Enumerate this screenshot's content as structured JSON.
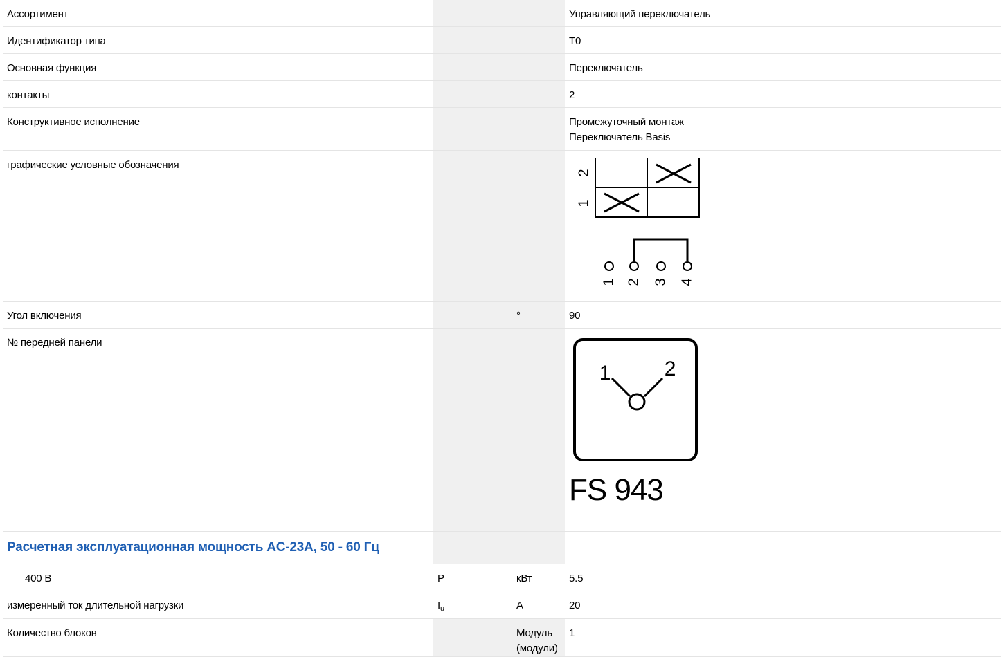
{
  "rows": {
    "assortment": {
      "label": "Ассортимент",
      "value": "Управляющий переключатель"
    },
    "type_id": {
      "label": "Идентификатор типа",
      "value": "T0"
    },
    "main_function": {
      "label": "Основная функция",
      "value": "Переключатель"
    },
    "contacts": {
      "label": "контакты",
      "value": "2"
    },
    "design": {
      "label": "Конструктивное исполнение",
      "value_line1": "Промежуточный монтаж",
      "value_line2": "Переключатель Basis"
    },
    "symbols": {
      "label": "графические условные обозначения",
      "diagram_row_labels": [
        "1",
        "2"
      ],
      "terminal_labels": [
        "1",
        "2",
        "3",
        "4"
      ]
    },
    "switch_angle": {
      "label": "Угол включения",
      "unit": "°",
      "value": "90"
    },
    "front_plate": {
      "label": "№ передней панели",
      "positions": [
        "1",
        "2"
      ],
      "plate_code": "FS 943"
    },
    "section": {
      "title": "Расчетная эксплуатационная мощность AC-23A, 50 - 60 Гц"
    },
    "power_400": {
      "label": "400 В",
      "symbol": "P",
      "unit": "кВт",
      "value": "5.5"
    },
    "rated_current": {
      "label": "измеренный ток длительной нагрузки",
      "symbol_main": "I",
      "symbol_sub": "u",
      "unit": "A",
      "value": "20"
    },
    "blocks": {
      "label": "Количество блоков",
      "unit_line1": "Модуль",
      "unit_line2": "(модули)",
      "value": "1"
    }
  }
}
